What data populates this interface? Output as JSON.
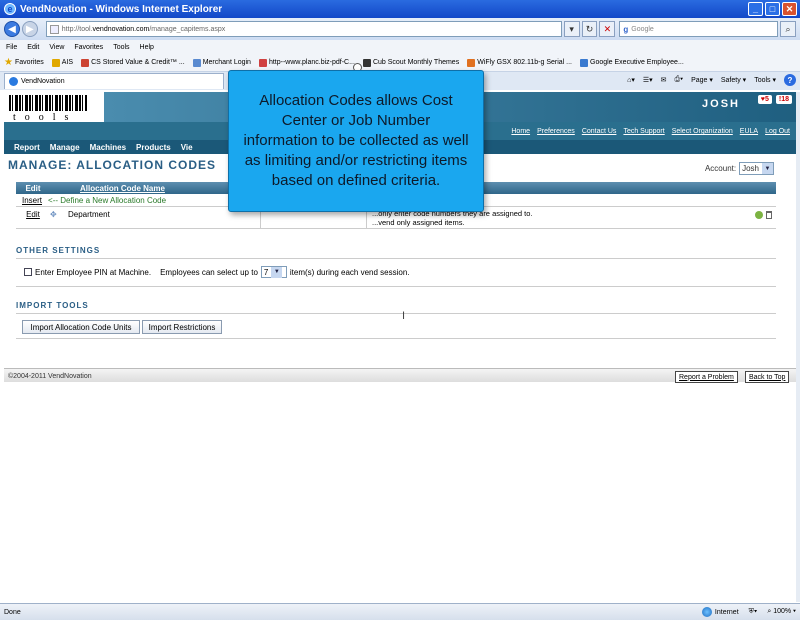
{
  "browser": {
    "title": "VendNovation - Windows Internet Explorer",
    "url_prefix": "http://tool.",
    "url_domain": "vendnovation.com",
    "url_path": "/manage_capitems.aspx",
    "search_placeholder": "Google",
    "menu": [
      "File",
      "Edit",
      "View",
      "Favorites",
      "Tools",
      "Help"
    ],
    "favorites_label": "Favorites",
    "favorites": [
      "AIS",
      "CS Stored Value & Credit™ ...",
      "Merchant Login",
      "http--www.planc.biz-pdf-C...",
      "Cub Scout Monthly Themes",
      "WiFly GSX 802.11b-g Serial ...",
      "Google Executive Employee..."
    ],
    "tab_label": "VendNovation",
    "command_bar": [
      "Page ▾",
      "Safety ▾",
      "Tools ▾"
    ],
    "status_left": "Done",
    "status_zone": "Internet",
    "zoom": "100%"
  },
  "site": {
    "logo_text": "tools",
    "user_name": "JOSH",
    "badge_hearts": "5",
    "badge_alerts": "18",
    "links": [
      "Home",
      "Preferences",
      "Contact Us",
      "Tech Support",
      "Select Organization",
      "EULA",
      "Log Out"
    ],
    "nav": [
      "Report",
      "Manage",
      "Machines",
      "Products",
      "Vie"
    ]
  },
  "page": {
    "title": "MANAGE: ALLOCATION CODES",
    "account_label": "Account:",
    "account_value": "Josh",
    "table": {
      "col_edit": "Edit",
      "col_name": "Allocation Code Name",
      "insert_label": "Insert",
      "insert_hint": "<-- Define a New Allocation Code",
      "rows": [
        {
          "edit": "Edit",
          "name": "Department",
          "note_1": "...only enter code numbers they are assigned to.",
          "note_2": "...vend only assigned items."
        }
      ]
    },
    "other_settings": {
      "title": "OTHER SETTINGS",
      "pin_label": "Enter Employee PIN at Machine.",
      "select_prefix": "Employees can select up to",
      "select_value": "7",
      "select_suffix": "item(s) during each vend session."
    },
    "import_tools": {
      "title": "IMPORT TOOLS",
      "btn_units": "Import Allocation Code Units",
      "btn_restrictions": "Import Restrictions"
    },
    "footer": {
      "copyright": "©2004-2011 VendNovation",
      "report": "Report a Problem",
      "back_to_top": "Back to Top"
    }
  },
  "callout": {
    "text": "Allocation Codes allows Cost Center or Job Number information to be collected as well as limiting and/or restricting items based on defined criteria."
  },
  "colors": {
    "header_teal": "#1b5878",
    "title_blue": "#2a5e85",
    "callout": "#1aa7ef"
  }
}
